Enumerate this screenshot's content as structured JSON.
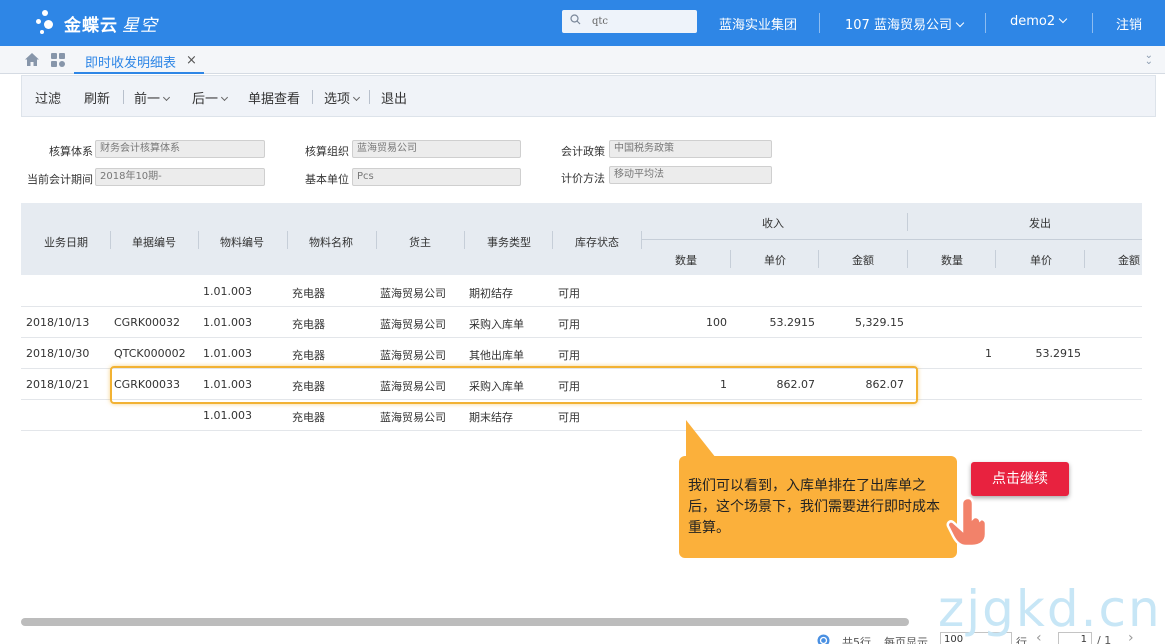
{
  "header": {
    "logo_text": "金蝶云",
    "logo_sub": "星空",
    "search_value": "qtc",
    "group": "蓝海实业集团",
    "company": "107 蓝海贸易公司",
    "user": "demo2",
    "logout": "注销",
    "bg_color": "#2e86e6"
  },
  "tabs": {
    "active_label": "即时收发明细表",
    "close": "×"
  },
  "toolbar": {
    "filter": "过滤",
    "refresh": "刷新",
    "prev": "前一",
    "next": "后一",
    "doc_view": "单据查看",
    "options": "选项",
    "exit": "退出"
  },
  "form": {
    "accounting_system_label": "核算体系",
    "accounting_system_value": "财务会计核算体系",
    "accounting_org_label": "核算组织",
    "accounting_org_value": "蓝海贸易公司",
    "policy_label": "会计政策",
    "policy_value": "中国税务政策",
    "period_label": "当前会计期间",
    "period_value": "2018年10期-",
    "unit_label": "基本单位",
    "unit_value": "Pcs",
    "pricing_label": "计价方法",
    "pricing_value": "移动平均法"
  },
  "grid": {
    "columns": {
      "date": "业务日期",
      "bill_no": "单据编号",
      "material_no": "物料编号",
      "material_name": "物料名称",
      "owner": "货主",
      "type": "事务类型",
      "stock_status": "库存状态",
      "in_group": "收入",
      "out_group": "发出",
      "qty": "数量",
      "price": "单价",
      "amount": "金额"
    },
    "rows": [
      {
        "date": "",
        "bill_no": "",
        "material_no": "1.01.003",
        "material_name": "充电器",
        "owner": "蓝海贸易公司",
        "type": "期初结存",
        "status": "可用",
        "in_qty": "",
        "in_price": "",
        "in_amount": "",
        "out_qty": "",
        "out_price": ""
      },
      {
        "date": "2018/10/13",
        "bill_no": "CGRK00032",
        "material_no": "1.01.003",
        "material_name": "充电器",
        "owner": "蓝海贸易公司",
        "type": "采购入库单",
        "status": "可用",
        "in_qty": "100",
        "in_price": "53.2915",
        "in_amount": "5,329.15",
        "out_qty": "",
        "out_price": ""
      },
      {
        "date": "2018/10/30",
        "bill_no": "QTCK000002",
        "material_no": "1.01.003",
        "material_name": "充电器",
        "owner": "蓝海贸易公司",
        "type": "其他出库单",
        "status": "可用",
        "in_qty": "",
        "in_price": "",
        "in_amount": "",
        "out_qty": "1",
        "out_price": "53.2915"
      },
      {
        "date": "2018/10/21",
        "bill_no": "CGRK00033",
        "material_no": "1.01.003",
        "material_name": "充电器",
        "owner": "蓝海贸易公司",
        "type": "采购入库单",
        "status": "可用",
        "in_qty": "1",
        "in_price": "862.07",
        "in_amount": "862.07",
        "out_qty": "",
        "out_price": ""
      },
      {
        "date": "",
        "bill_no": "",
        "material_no": "1.01.003",
        "material_name": "充电器",
        "owner": "蓝海贸易公司",
        "type": "期末结存",
        "status": "可用",
        "in_qty": "",
        "in_price": "",
        "in_amount": "",
        "out_qty": "",
        "out_price": ""
      }
    ]
  },
  "callout": {
    "text": "我们可以看到，入库单排在了出库单之后，这个场景下，我们需要进行即时成本重算。",
    "button": "点击继续"
  },
  "footer": {
    "total": "共5行",
    "per_page": "每页显示",
    "per_page_value": "100",
    "row_unit": "行",
    "page_value": "1",
    "page_total": "/ 1"
  },
  "watermark": "zjgkd.cn"
}
